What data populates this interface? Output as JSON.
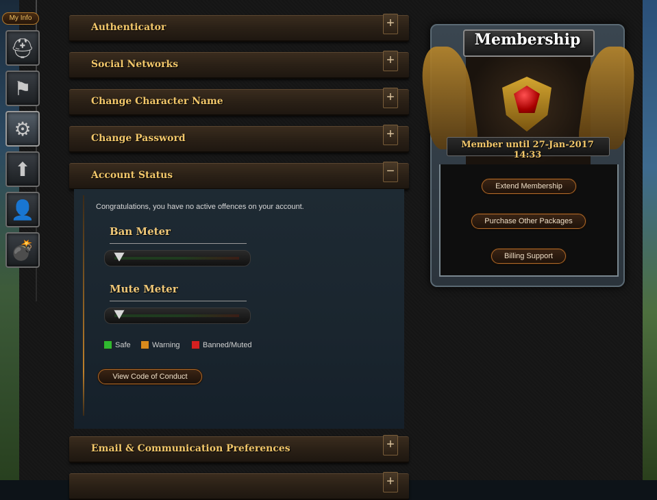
{
  "sidebar": {
    "my_info_label": "My Info",
    "items": [
      {
        "name": "helmet-icon",
        "glyph": "⛑"
      },
      {
        "name": "banner-icon",
        "glyph": "⚑"
      },
      {
        "name": "gear-icon",
        "glyph": "⚙"
      },
      {
        "name": "upgrade-arrow-icon",
        "glyph": "⬆"
      },
      {
        "name": "add-friend-icon",
        "glyph": "👤"
      },
      {
        "name": "bomb-icon",
        "glyph": "💣"
      }
    ]
  },
  "accordion": {
    "authenticator": {
      "title": "Authenticator",
      "toggle": "+"
    },
    "social": {
      "title": "Social Networks",
      "toggle": "+"
    },
    "char_name": {
      "title": "Change Character Name",
      "toggle": "+"
    },
    "password": {
      "title": "Change Password",
      "toggle": "+"
    },
    "account_status": {
      "title": "Account Status",
      "toggle": "−"
    },
    "email": {
      "title": "Email & Communication Preferences",
      "toggle": "+"
    },
    "next": {
      "title": "",
      "toggle": "+"
    }
  },
  "account_status": {
    "message": "Congratulations, you have no active offences on your account.",
    "ban_meter": {
      "title": "Ban Meter",
      "level": 0
    },
    "mute_meter": {
      "title": "Mute Meter",
      "level": 0
    },
    "legend": [
      {
        "label": "Safe",
        "color": "#2fb82f"
      },
      {
        "label": "Warning",
        "color": "#d98a1c"
      },
      {
        "label": "Banned/Muted",
        "color": "#d42020"
      }
    ],
    "code_of_conduct_button": "View Code of Conduct"
  },
  "membership": {
    "title": "Membership",
    "member_until": "Member until 27-Jan-2017 14:33",
    "buttons": {
      "extend": "Extend Membership",
      "purchase": "Purchase Other Packages",
      "billing": "Billing Support"
    }
  },
  "colors": {
    "accent_gold": "#f2c76a",
    "button_border": "#b06a2a"
  }
}
